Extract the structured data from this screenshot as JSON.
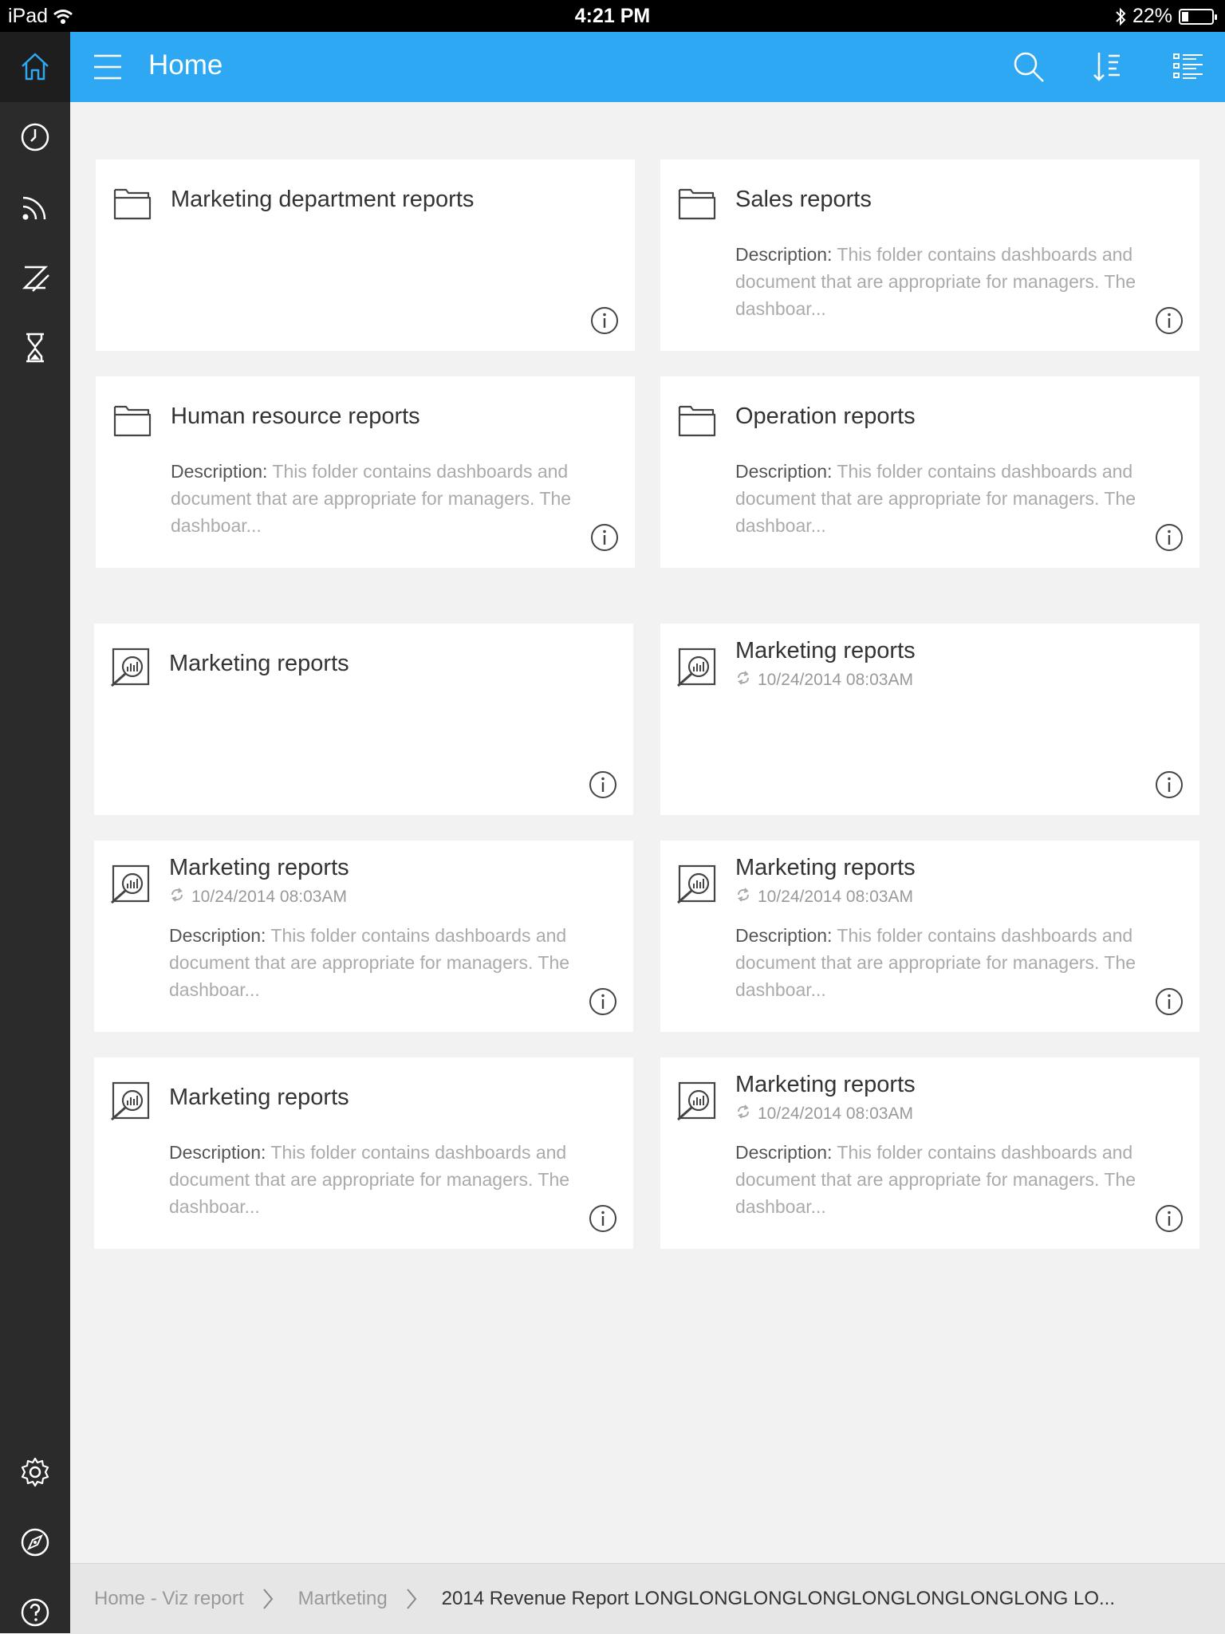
{
  "status_bar": {
    "device": "iPad",
    "time": "4:21 PM",
    "battery": "22%",
    "battery_level": 0.22
  },
  "header": {
    "title": "Home",
    "accent_color": "#2ea8f3"
  },
  "sidebar": {
    "items": [
      {
        "icon": "home-icon"
      },
      {
        "icon": "clock-icon"
      },
      {
        "icon": "feed-icon"
      },
      {
        "icon": "edit-icon"
      },
      {
        "icon": "hourglass-icon"
      },
      {
        "icon": "gear-icon"
      },
      {
        "icon": "compass-icon"
      },
      {
        "icon": "help-icon"
      }
    ]
  },
  "description_label": "Description:",
  "cards": [
    {
      "title": "Marketing department reports",
      "type": "folder",
      "date": "",
      "description": ""
    },
    {
      "title": "Sales reports",
      "type": "folder",
      "date": "",
      "description": "This folder contains dashboards and document that are appropriate for managers. The dashboar..."
    },
    {
      "title": "Human resource reports",
      "type": "folder",
      "date": "",
      "description": "This folder contains dashboards and document that are appropriate for managers. The dashboar..."
    },
    {
      "title": "Operation reports",
      "type": "folder",
      "date": "",
      "description": "This folder contains dashboards and document that are appropriate for managers. The dashboar..."
    },
    {
      "title": "Marketing reports",
      "type": "report",
      "date": "",
      "description": ""
    },
    {
      "title": "Marketing reports",
      "type": "report",
      "date": "10/24/2014 08:03AM",
      "description": ""
    },
    {
      "title": "Marketing reports",
      "type": "report",
      "date": "10/24/2014 08:03AM",
      "description": "This folder contains dashboards and document that are appropriate for managers. The dashboar..."
    },
    {
      "title": "Marketing reports",
      "type": "report",
      "date": "10/24/2014 08:03AM",
      "description": "This folder contains dashboards and document that are appropriate for managers. The dashboar..."
    },
    {
      "title": "Marketing reports",
      "type": "report",
      "date": "",
      "description": "This folder contains dashboards and document that are appropriate for managers. The dashboar..."
    },
    {
      "title": "Marketing reports",
      "type": "report",
      "date": "10/24/2014 08:03AM",
      "description": "This folder contains dashboards and document that are appropriate for managers. The dashboar..."
    }
  ],
  "breadcrumb": {
    "items": [
      "Home - Viz report",
      "Martketing",
      "2014 Revenue Report LONGLONGLONGLONGLONGLONGLONGLONG LO..."
    ]
  }
}
